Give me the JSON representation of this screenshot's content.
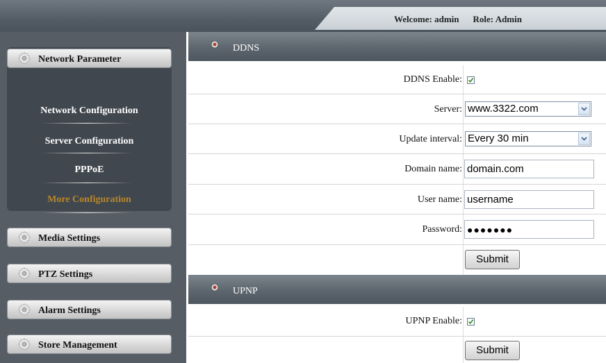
{
  "header": {
    "welcome_label": "Welcome:",
    "welcome_user": "admin",
    "role_label": "Role:",
    "role_value": "Admin"
  },
  "sidebar": {
    "network_parameter": {
      "label": "Network Parameter",
      "items": [
        {
          "label": "Network Configuration"
        },
        {
          "label": "Server Configuration"
        },
        {
          "label": "PPPoE"
        },
        {
          "label": "More Configuration",
          "active": true
        }
      ]
    },
    "groups": [
      {
        "label": "Media Settings"
      },
      {
        "label": "PTZ Settings"
      },
      {
        "label": "Alarm Settings"
      },
      {
        "label": "Store Management"
      }
    ]
  },
  "ddns": {
    "title": "DDNS",
    "enable_label": "DDNS Enable:",
    "enable_checked": true,
    "server_label": "Server:",
    "server_value": "www.3322.com",
    "interval_label": "Update interval:",
    "interval_value": "Every 30 min",
    "domain_label": "Domain name:",
    "domain_value": "domain.com",
    "user_label": "User name:",
    "user_value": "username",
    "password_label": "Password:",
    "password_value": "●●●●●●●",
    "submit_label": "Submit"
  },
  "upnp": {
    "title": "UPNP",
    "enable_label": "UPNP Enable:",
    "enable_checked": true,
    "submit_label": "Submit"
  },
  "colors": {
    "active_item": "#b8862b",
    "header_gray": "#5d666e",
    "sidebar_bg": "#565d64"
  }
}
